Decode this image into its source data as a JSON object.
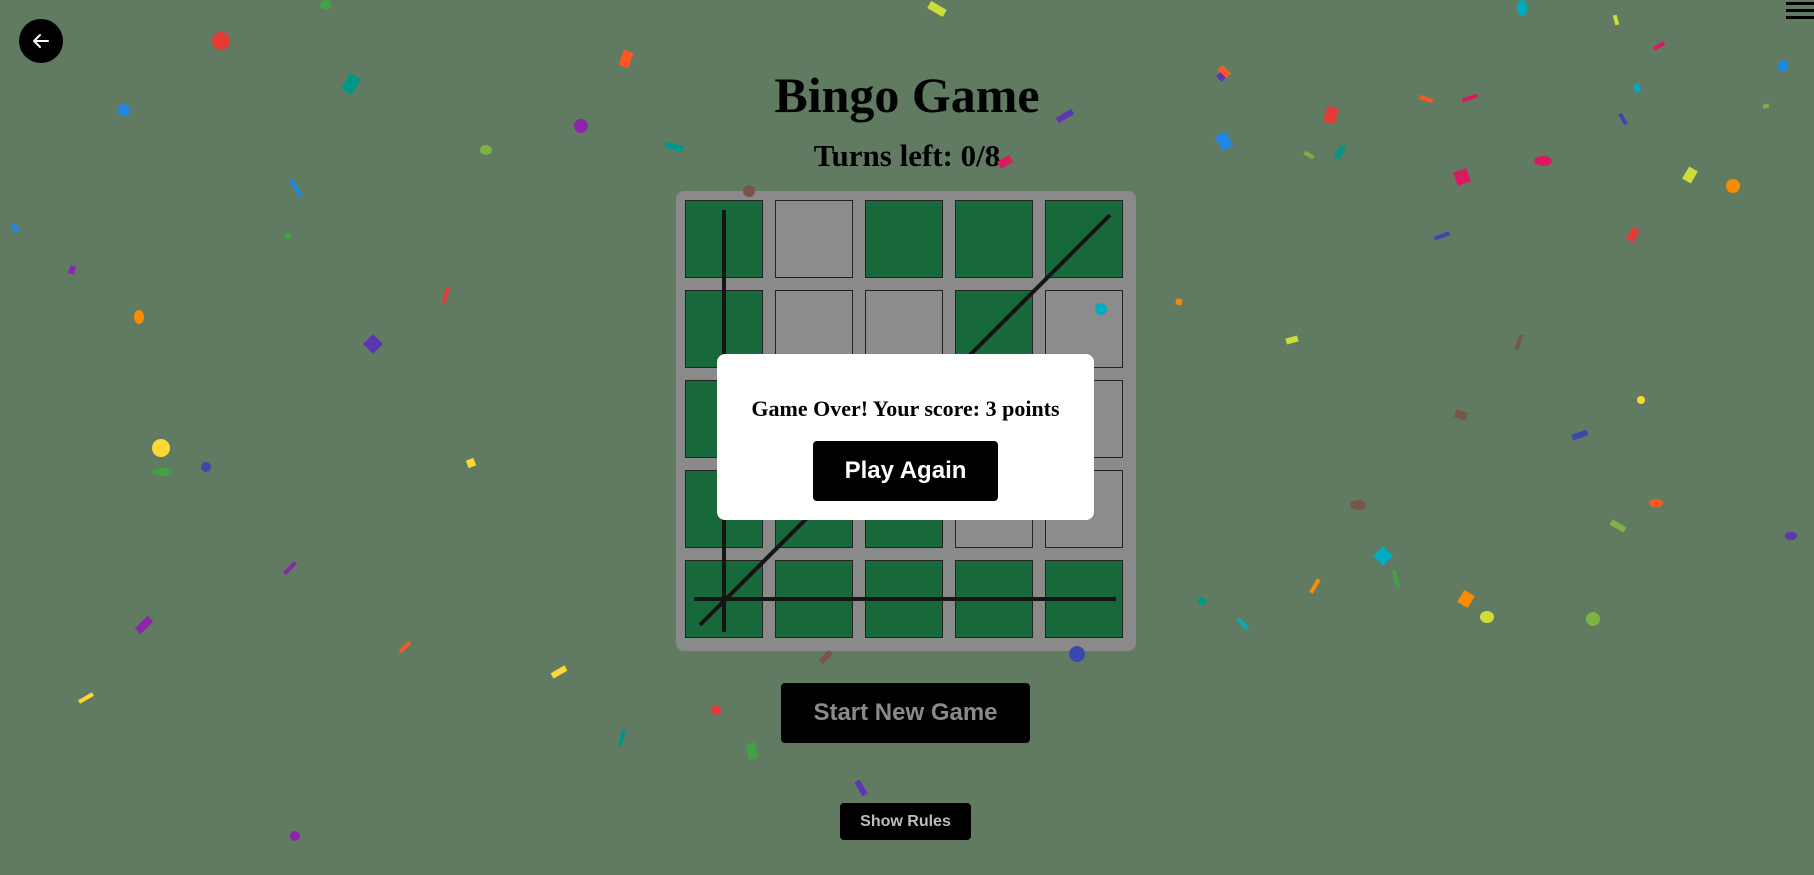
{
  "header": {
    "back_icon": "arrow-left-icon",
    "menu_icon": "hamburger-menu-icon"
  },
  "game": {
    "title": "Bingo Game",
    "turns_label": "Turns left: 0/8"
  },
  "board": {
    "rows": [
      [
        true,
        false,
        true,
        true,
        true
      ],
      [
        true,
        false,
        false,
        true,
        false
      ],
      [
        true,
        false,
        false,
        false,
        false
      ],
      [
        true,
        true,
        true,
        false,
        false
      ],
      [
        true,
        true,
        true,
        true,
        true
      ]
    ],
    "cell_on_color": "#17683a",
    "cell_off_color": "#8c8c8c",
    "winning_lines": [
      "column-1",
      "row-5",
      "diagonal-anti"
    ]
  },
  "modal": {
    "message": "Game Over! Your score: 3 points",
    "button_label": "Play Again"
  },
  "controls": {
    "start_label": "Start New Game",
    "rules_label": "Show Rules"
  },
  "colors": {
    "background": "#617b63",
    "confetti": [
      "#e53935",
      "#1e88e5",
      "#8e24aa",
      "#fdd835",
      "#43a047",
      "#fb8c00",
      "#00acc1",
      "#795548",
      "#3949ab",
      "#7cb342",
      "#009688",
      "#5e35b1",
      "#ff5722",
      "#d81b60",
      "#cddc39"
    ]
  }
}
